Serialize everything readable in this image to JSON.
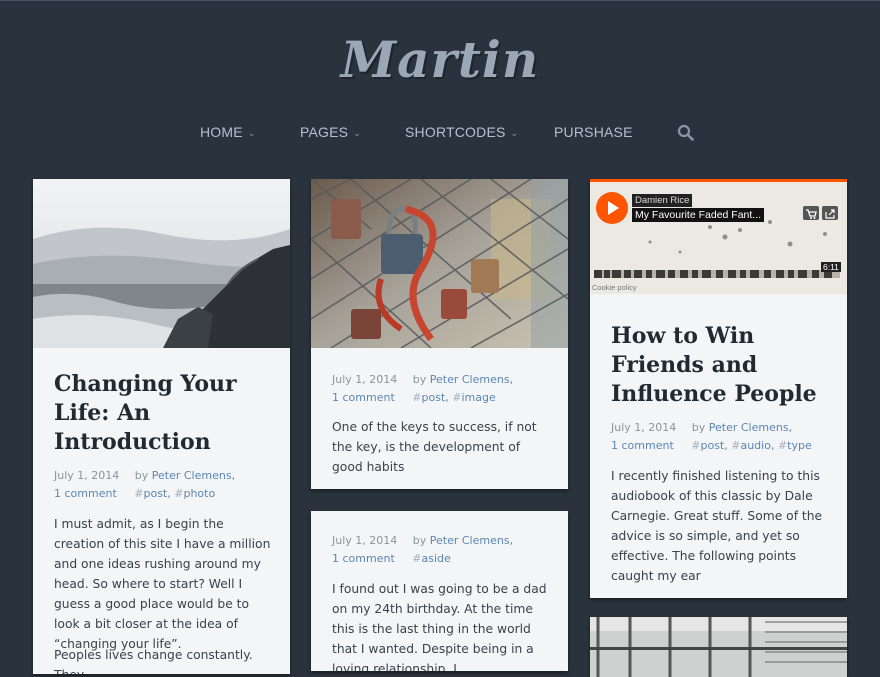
{
  "site": {
    "logo": "Martin"
  },
  "nav": {
    "items": [
      {
        "label": "HOME",
        "dropdown": true
      },
      {
        "label": "PAGES",
        "dropdown": true
      },
      {
        "label": "SHORTCODES",
        "dropdown": true
      },
      {
        "label": "PURSHASE",
        "dropdown": false
      }
    ],
    "search_icon": "search-icon"
  },
  "posts": [
    {
      "title": "Changing Your Life: An Introduction",
      "date": "July 1, 2014",
      "by": "by",
      "author": "Peter Clemens,",
      "comments": "1 comment",
      "tags": [
        "post,",
        "photo"
      ],
      "excerpt": "I must admit, as I begin the creation of this site I have a million and one ideas rushing around my head. So where to start? Well I guess a good place would be to look a bit closer at the idea of “changing your life”.",
      "excerpt2": "Peoples lives change constantly. They"
    },
    {
      "date": "July 1, 2014",
      "by": "by",
      "author": "Peter Clemens,",
      "comments": "1 comment",
      "tags": [
        "post,",
        "image"
      ],
      "excerpt": "One of the keys to success, if not the key, is the development of good habits"
    },
    {
      "date": "July 1, 2014",
      "by": "by",
      "author": "Peter Clemens,",
      "comments": "1 comment",
      "tags": [
        "aside"
      ],
      "excerpt": "I found out I was going to be a dad on my 24th birthday. At the time this is the last thing in the world that I wanted. Despite being in a loving relationship, I"
    },
    {
      "title": "How to Win Friends and Influence People",
      "date": "July 1, 2014",
      "by": "by",
      "author": "Peter Clemens,",
      "comments": "1 comment",
      "tags": [
        "post,",
        "audio,",
        "type"
      ],
      "excerpt": "I recently finished listening to this audiobook of this classic by Dale Carnegie. Great stuff. Some of the advice is so simple, and yet so effective. The following points caught my ear"
    }
  ],
  "player": {
    "artist": "Damien Rice",
    "track": "My Favourite Faded Fant...",
    "duration": "6:11",
    "cookie": "Cookie policy",
    "accent": "#ff5500"
  },
  "colors": {
    "background": "#2a333d",
    "card": "#f4f5f7",
    "link": "#5a86b3"
  }
}
